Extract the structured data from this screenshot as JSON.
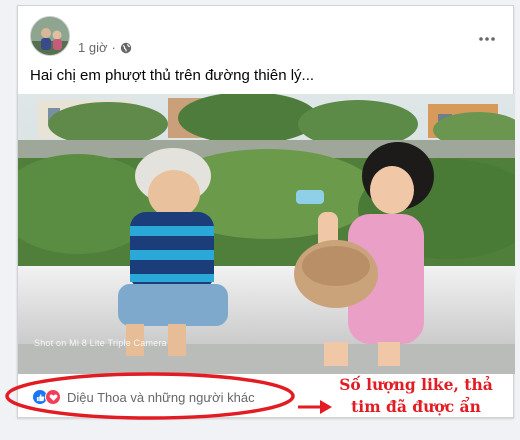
{
  "post": {
    "timestamp": "1 giờ",
    "separator": "·",
    "privacy_icon": "globe-icon",
    "more_icon": "more-horizontal-icon",
    "text": "Hai chị em phượt thủ trên đường thiên lý..."
  },
  "photo": {
    "watermark": "Shot on Mi 8 Lite Triple Camera"
  },
  "reactions": {
    "icons": [
      "like-icon",
      "love-icon"
    ],
    "summary": "Diệu Thoa và những người khác"
  },
  "annotation": {
    "line1": "Số lượng like, thả",
    "line2": "tim đã được ẩn",
    "color": "#e31b23"
  },
  "colors": {
    "like_blue": "#1877f2",
    "love_red": "#f33e58",
    "secondary_text": "#65676b"
  }
}
